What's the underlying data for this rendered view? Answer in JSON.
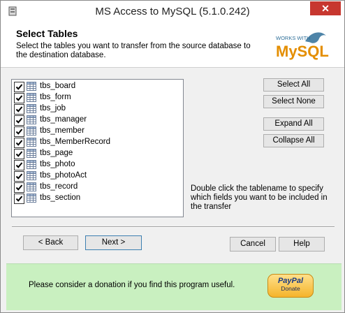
{
  "window": {
    "title": "MS Access to MySQL (5.1.0.242)",
    "close_glyph": "✕"
  },
  "header": {
    "title": "Select Tables",
    "description": "Select the tables you want to transfer from the source database to the destination database.",
    "logo_top": "WORKS WITH",
    "logo_main": "MySQL"
  },
  "tables": [
    {
      "name": "tbs_board",
      "checked": true
    },
    {
      "name": "tbs_form",
      "checked": true
    },
    {
      "name": "tbs_job",
      "checked": true
    },
    {
      "name": "tbs_manager",
      "checked": true
    },
    {
      "name": "tbs_member",
      "checked": true
    },
    {
      "name": "tbs_MemberRecord",
      "checked": true
    },
    {
      "name": "tbs_page",
      "checked": true
    },
    {
      "name": "tbs_photo",
      "checked": true
    },
    {
      "name": "tbs_photoAct",
      "checked": true
    },
    {
      "name": "tbs_record",
      "checked": true
    },
    {
      "name": "tbs_section",
      "checked": true
    }
  ],
  "buttons": {
    "select_all": "Select All",
    "select_none": "Select None",
    "expand_all": "Expand All",
    "collapse_all": "Collapse All",
    "back": "< Back",
    "next": "Next >",
    "cancel": "Cancel",
    "help": "Help"
  },
  "hint": "Double click the tablename to specify which fields you want to be included in the transfer",
  "footer": {
    "donation_text": "Please consider a donation if you find this program useful.",
    "paypal_logo": "PayPal",
    "paypal_label": "Donate"
  },
  "colors": {
    "footer_bg": "#c9f0c0",
    "close_bg": "#c7372f",
    "default_button_border": "#3c7fb1"
  }
}
